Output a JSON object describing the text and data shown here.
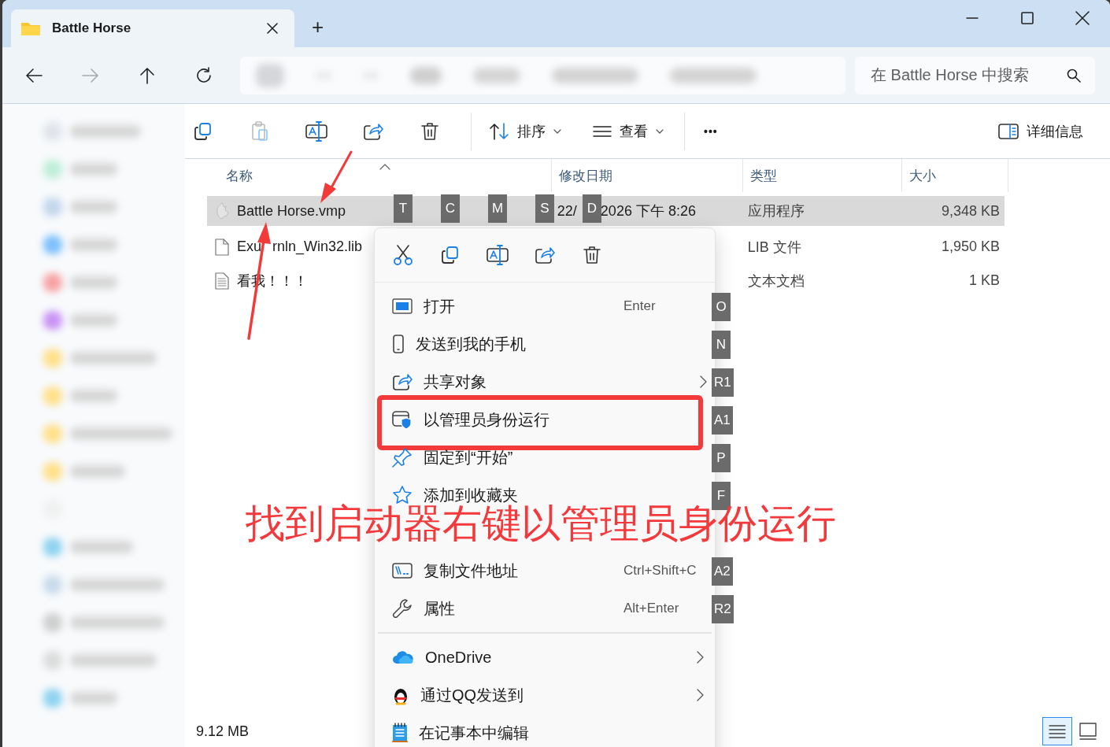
{
  "window": {
    "title": "Battle Horse",
    "new_tab": "+"
  },
  "search": {
    "placeholder": "在 Battle Horse 中搜索"
  },
  "nav": [
    {
      "kind": "back",
      "disabled": false
    },
    {
      "kind": "forward",
      "disabled": true
    },
    {
      "kind": "up",
      "disabled": false
    },
    {
      "kind": "refresh",
      "disabled": false
    }
  ],
  "toolbar": {
    "actions": [
      {
        "kind": "copy",
        "disabled": false
      },
      {
        "kind": "paste",
        "disabled": true
      },
      {
        "kind": "rename",
        "disabled": false
      },
      {
        "kind": "share",
        "disabled": false
      },
      {
        "kind": "delete",
        "disabled": false
      }
    ],
    "sort": "排序",
    "view": "查看",
    "more": "•••",
    "details": "详细信息"
  },
  "columns": [
    {
      "label": "名称",
      "sorted": true
    },
    {
      "label": "修改日期",
      "sorted": false
    },
    {
      "label": "类型",
      "sorted": false
    },
    {
      "label": "大小",
      "sorted": false
    }
  ],
  "rows": [
    {
      "kind": "app",
      "name": "Battle Horse.vmp",
      "date_start": "22/",
      "date_end": "2026 下午 8:26",
      "type": "应用程序",
      "size": "9,348 KB",
      "selected": true
    },
    {
      "kind": "file",
      "name": "Exu",
      "name_end": "rnln_Win32.lib",
      "type": "LIB 文件",
      "size": "1,950 KB",
      "selected": false
    },
    {
      "kind": "text",
      "name": "看我！！！",
      "type": "文本文档",
      "size": "1 KB",
      "selected": false
    }
  ],
  "key_tips": [
    "T",
    "C",
    "M",
    "S",
    "D"
  ],
  "context_menu": {
    "actions": [
      {
        "kind": "cut"
      },
      {
        "kind": "copy"
      },
      {
        "kind": "rename"
      },
      {
        "kind": "share"
      },
      {
        "kind": "delete"
      }
    ],
    "groups": [
      [
        {
          "kind": "open",
          "label": "打开",
          "shortcut": "Enter",
          "submenu": false,
          "key_tip": "O",
          "boxed": false
        },
        {
          "kind": "phone",
          "label": "发送到我的手机",
          "submenu": false,
          "key_tip": "N",
          "boxed": false
        },
        {
          "kind": "share",
          "label": "共享对象",
          "submenu": true,
          "key_tip": "R1",
          "boxed": false
        },
        {
          "kind": "admin",
          "label": "以管理员身份运行",
          "submenu": false,
          "key_tip": "A1",
          "boxed": true
        },
        {
          "kind": "pin",
          "label": "固定到“开始”",
          "submenu": false,
          "key_tip": "P",
          "boxed": false
        },
        {
          "kind": "star",
          "label": "添加到收藏夹",
          "submenu": false,
          "key_tip": "F",
          "boxed": false
        },
        {
          "kind": "path",
          "label": "复制文件地址",
          "shortcut": "Ctrl+Shift+C",
          "submenu": false,
          "key_tip": "A2",
          "boxed": false
        },
        {
          "kind": "wrench",
          "label": "属性",
          "shortcut": "Alt+Enter",
          "submenu": false,
          "key_tip": "R2",
          "boxed": false
        }
      ],
      [
        {
          "kind": "cloud",
          "label": "OneDrive",
          "submenu": true,
          "boxed": false
        },
        {
          "kind": "penguin",
          "label": "通过QQ发送到",
          "submenu": true,
          "boxed": false
        },
        {
          "kind": "notepad",
          "label": "在记事本中编辑",
          "submenu": false,
          "boxed": false
        }
      ]
    ]
  },
  "caption": "找到启动器右键以管理员身份运行",
  "status_bar": {
    "size": "9.12 MB"
  },
  "view_buttons": [
    {
      "kind": "details",
      "selected": true
    },
    {
      "kind": "tiles",
      "selected": false
    }
  ]
}
